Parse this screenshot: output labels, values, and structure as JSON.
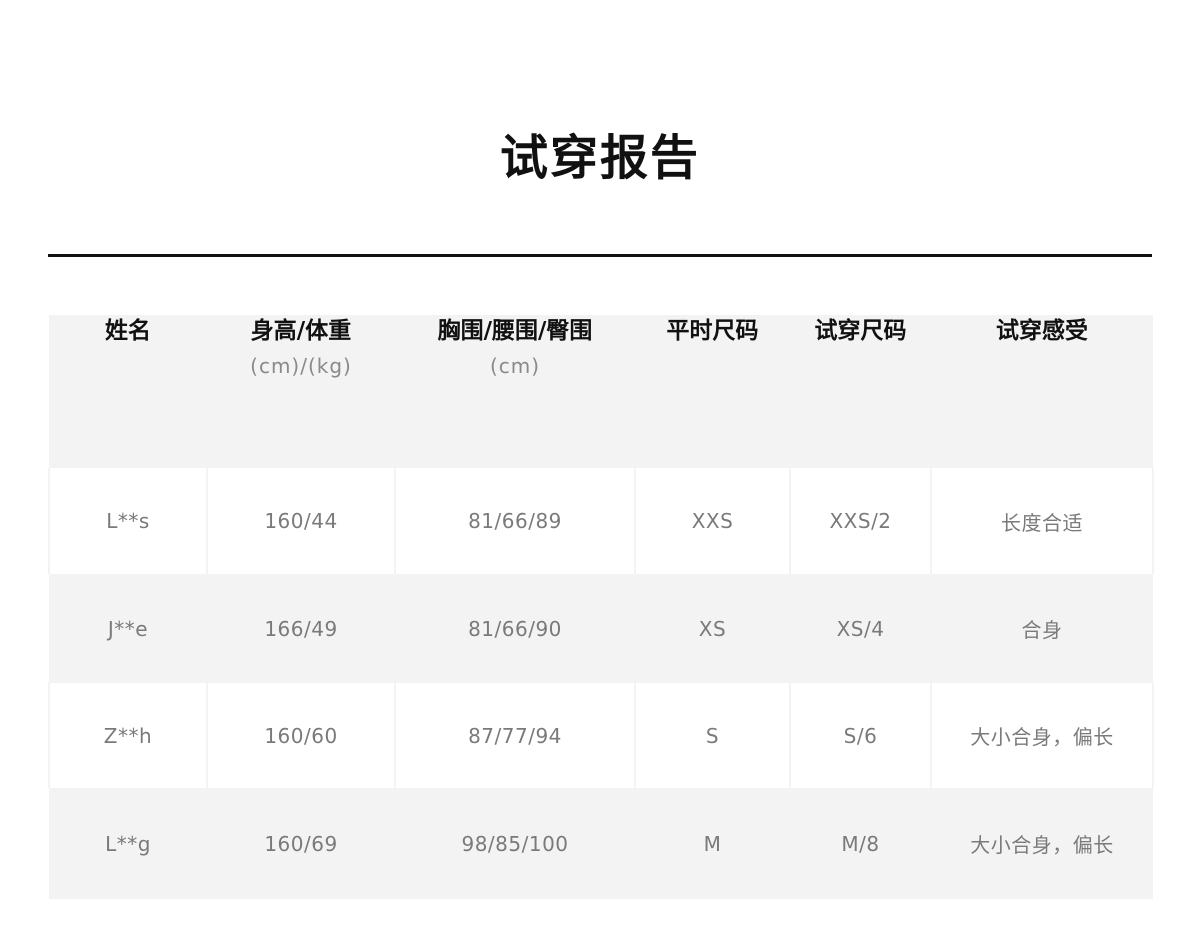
{
  "title": "试穿报告",
  "table": {
    "headers": [
      {
        "main": "姓名",
        "sub": ""
      },
      {
        "main": "身高/体重",
        "sub": "(cm)/(kg)"
      },
      {
        "main": "胸围/腰围/臀围",
        "sub": "(cm)"
      },
      {
        "main": "平时尺码",
        "sub": ""
      },
      {
        "main": "试穿尺码",
        "sub": ""
      },
      {
        "main": "试穿感受",
        "sub": ""
      }
    ],
    "rows": [
      [
        "L**s",
        "160/44",
        "81/66/89",
        "XXS",
        "XXS/2",
        "长度合适"
      ],
      [
        "J**e",
        "166/49",
        "81/66/90",
        "XS",
        "XS/4",
        "合身"
      ],
      [
        "Z**h",
        "160/60",
        "87/77/94",
        "S",
        "S/6",
        "大小合身，偏长"
      ],
      [
        "L**g",
        "160/69",
        "98/85/100",
        "M",
        "M/8",
        "大小合身，偏长"
      ]
    ]
  }
}
